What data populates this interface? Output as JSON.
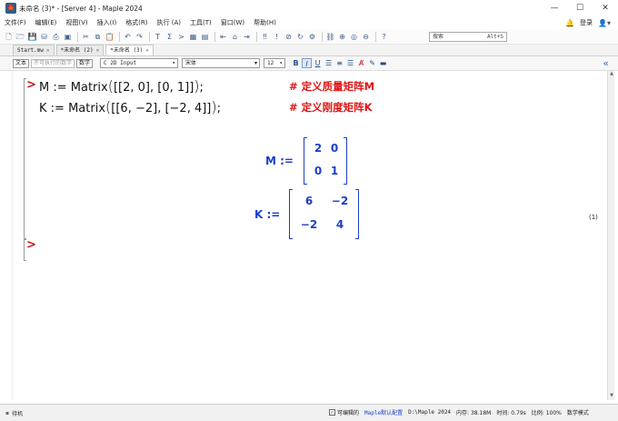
{
  "window": {
    "title": "未命名 (3)* - [Server 4] - Maple 2024",
    "app_icon": "maple-leaf-icon",
    "controls": [
      "minimize-icon",
      "maximize-icon",
      "close-icon"
    ],
    "control_glyphs": [
      "—",
      "☐",
      "✕"
    ]
  },
  "menubar": {
    "items": [
      "文件(F)",
      "编辑(E)",
      "视图(V)",
      "插入(I)",
      "格式(R)",
      "执行 (A)",
      "工具(T)",
      "窗口(W)",
      "帮助(H)"
    ],
    "login_label": "登录"
  },
  "toolbar": {
    "search_placeholder": "搜索",
    "search_shortcut": "Alt+S"
  },
  "tabs": [
    {
      "label": "Start.mw",
      "active": false
    },
    {
      "label": "*未命名 (2)",
      "active": false
    },
    {
      "label": "*未命名 (3)",
      "active": true
    }
  ],
  "context_bar": {
    "text_button": "文本",
    "nonexec_button": "不可执行的数学",
    "math_button": "数学",
    "style_dropdown": "C  2D Input",
    "font_dropdown": "宋体",
    "size_dropdown": "12",
    "bold": "B",
    "italic": "I",
    "underline": "U"
  },
  "document": {
    "prompt": ">",
    "inputs": [
      {
        "var": "M",
        "assign": ":=",
        "fn": "Matrix",
        "args": "[[2, 0], [0, 1]]",
        "terminator": ";",
        "comment": "# 定义质量矩阵M"
      },
      {
        "var": "K",
        "assign": ":=",
        "fn": "Matrix",
        "args": "[[6, −2], [−2, 4]]",
        "terminator": ";",
        "comment": "# 定义刚度矩阵K"
      }
    ],
    "outputs": [
      {
        "label": "M :=",
        "matrix": [
          [
            "2",
            "0"
          ],
          [
            "0",
            "1"
          ]
        ]
      },
      {
        "label": "K :=",
        "matrix": [
          [
            "6",
            "−2"
          ],
          [
            "−2",
            "4"
          ]
        ]
      }
    ],
    "equation_number": "(1)",
    "next_prompt": ">"
  },
  "statusbar": {
    "state": "待机",
    "editable_label": "可编辑的",
    "config": "Maple默认配置",
    "path": "D:\\Maple 2024",
    "memory": "内存: 38.18M",
    "time": "时间: 0.79s",
    "zoom": "比例: 100%",
    "mode": "数学模式"
  }
}
